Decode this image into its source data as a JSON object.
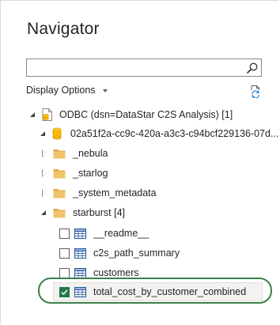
{
  "dialog": {
    "title": "Navigator"
  },
  "search": {
    "value": "",
    "placeholder": ""
  },
  "toolbar": {
    "display_options_label": "Display Options"
  },
  "tree": {
    "root": {
      "label": "ODBC (dsn=DataStar C2S Analysis) [1]",
      "expanded": true
    },
    "database": {
      "label": "02a51f2a-cc9c-420a-a3c3-c94bcf229136-07d...",
      "expanded": true
    },
    "folders": [
      {
        "label": "_nebula",
        "expanded": false
      },
      {
        "label": "_starlog",
        "expanded": false
      },
      {
        "label": "_system_metadata",
        "expanded": false
      },
      {
        "label": "starburst [4]",
        "expanded": true
      }
    ],
    "tables": [
      {
        "label": "__readme__",
        "checked": false
      },
      {
        "label": "c2s_path_summary",
        "checked": false
      },
      {
        "label": "customers",
        "checked": false
      },
      {
        "label": "total_cost_by_customer_combined",
        "checked": true
      }
    ]
  },
  "colors": {
    "folder": "#f0c469",
    "folder_tab": "#dba94a",
    "checkbox_checked": "#1f7a48",
    "highlight_ring": "#3c7f4a",
    "table_icon": "#2b579a"
  }
}
